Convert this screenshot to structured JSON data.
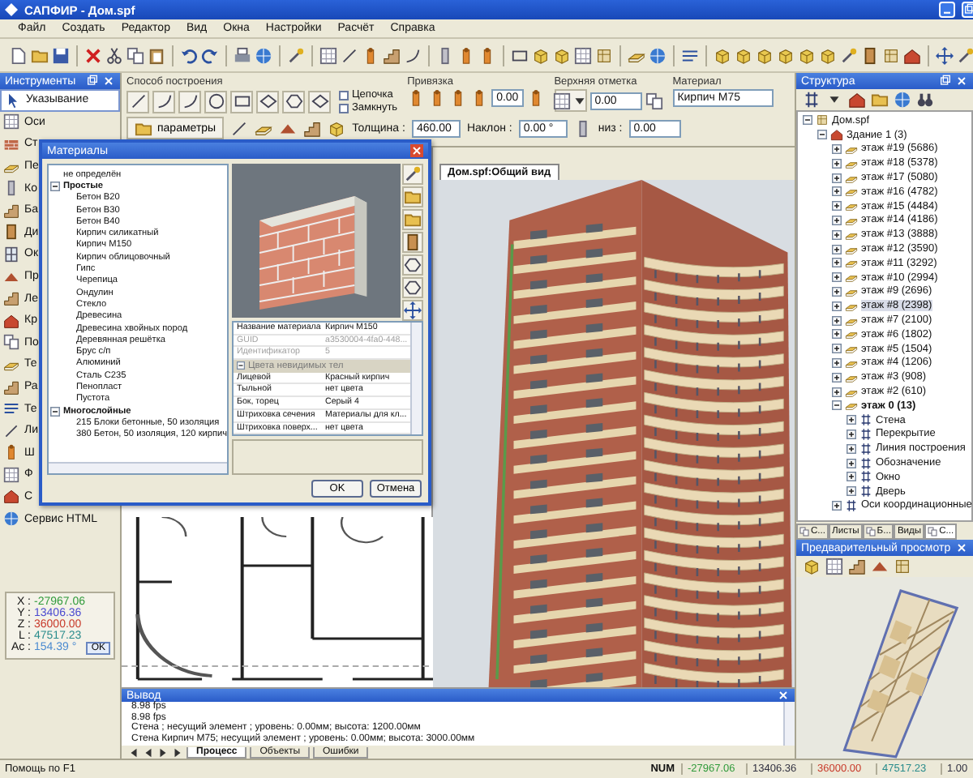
{
  "window": {
    "title": "САПФИР - Дом.spf"
  },
  "menu": [
    "Файл",
    "Создать",
    "Редактор",
    "Вид",
    "Окна",
    "Настройки",
    "Расчёт",
    "Справка"
  ],
  "tools_panel": {
    "title": "Инструменты",
    "items": [
      {
        "label": "Указывание",
        "selected": true
      },
      {
        "label": "Оси",
        "selected": false
      },
      {
        "label": "Ст",
        "selected": false
      },
      {
        "label": "Пе",
        "selected": false
      },
      {
        "label": "Ко",
        "selected": false
      },
      {
        "label": "Ба",
        "selected": false
      },
      {
        "label": "Ди",
        "selected": false
      },
      {
        "label": "Ок",
        "selected": false
      },
      {
        "label": "Пр",
        "selected": false
      },
      {
        "label": "Ле",
        "selected": false
      },
      {
        "label": "Кр",
        "selected": false
      },
      {
        "label": "По",
        "selected": false
      },
      {
        "label": "Те",
        "selected": false
      },
      {
        "label": "Ра",
        "selected": false
      },
      {
        "label": "Те",
        "selected": false
      },
      {
        "label": "Ли",
        "selected": false
      },
      {
        "label": "Ш",
        "selected": false
      },
      {
        "label": "Ф",
        "selected": false
      },
      {
        "label": "С",
        "selected": false
      },
      {
        "label": "Сервис HTML",
        "selected": false
      }
    ]
  },
  "coordinates": [
    {
      "label": "X :",
      "value": "-27967.06",
      "color": "#2f9a3a"
    },
    {
      "label": "Y :",
      "value": "13406.36",
      "color": "#4a4ad0"
    },
    {
      "label": "Z :",
      "value": "36000.00",
      "color": "#c83a2a"
    },
    {
      "label": "L :",
      "value": "47517.23",
      "color": "#2a8c8c"
    },
    {
      "label": "Ас :",
      "value": "154.39 °",
      "color": "#4a8ad0"
    }
  ],
  "coordinates_button": "OK",
  "construction": {
    "caption": "Способ построения",
    "chain": {
      "label": "Цепочка",
      "checked": false
    },
    "close": {
      "label": "Замкнуть",
      "checked": false
    },
    "params_button": "параметры",
    "thickness": {
      "label": "Толщина :",
      "value": "460.00"
    },
    "tilt": {
      "label": "Наклон :",
      "value": "0.00 °"
    },
    "bottom": {
      "label": "низ :",
      "value": "0.00"
    }
  },
  "snap": {
    "caption": "Привязка",
    "value": "0.00"
  },
  "top_mark": {
    "caption": "Верхняя отметка",
    "value": "0.00"
  },
  "material": {
    "caption": "Материал",
    "value": "Кирпич M75"
  },
  "document_tab": "Дом.spf:Общий вид",
  "materials_dialog": {
    "title": "Материалы",
    "tree": [
      {
        "label": "не определён",
        "kind": "item"
      },
      {
        "label": "Простые",
        "kind": "group",
        "expanded": true,
        "children": [
          {
            "label": "Бетон B20",
            "kind": "item"
          },
          {
            "label": "Бетон B30",
            "kind": "item"
          },
          {
            "label": "Бетон B40",
            "kind": "item"
          },
          {
            "label": "Кирпич силикатный",
            "kind": "item"
          },
          {
            "label": "Кирпич M150",
            "kind": "item"
          },
          {
            "label": "Кирпич облицовочный",
            "kind": "item"
          },
          {
            "label": "Гипс",
            "kind": "item"
          },
          {
            "label": "Черепица",
            "kind": "item"
          },
          {
            "label": "Ондулин",
            "kind": "item"
          },
          {
            "label": "Стекло",
            "kind": "item"
          },
          {
            "label": "Древесина",
            "kind": "item"
          },
          {
            "label": "Древесина хвойных пород",
            "kind": "item"
          },
          {
            "label": "Деревянная решётка",
            "kind": "item"
          },
          {
            "label": "Брус с/п",
            "kind": "item"
          },
          {
            "label": "Алюминий",
            "kind": "item"
          },
          {
            "label": "Сталь С235",
            "kind": "item"
          },
          {
            "label": "Пенопласт",
            "kind": "item"
          },
          {
            "label": "Пустота",
            "kind": "item"
          }
        ]
      },
      {
        "label": "Многослойные",
        "kind": "group",
        "expanded": true,
        "children": [
          {
            "label": "215 Блоки бетонные, 50 изоляция",
            "kind": "item"
          },
          {
            "label": "380 Бетон, 50 изоляция, 120 кирпич",
            "kind": "item"
          }
        ]
      }
    ],
    "properties": [
      {
        "kind": "property",
        "name": "Название материала",
        "value": "Кирпич M150",
        "disabled": false
      },
      {
        "kind": "property",
        "name": "GUID",
        "value": "a3530004-4fa0-448...",
        "disabled": true
      },
      {
        "kind": "property",
        "name": "Идентификатор",
        "value": "5",
        "disabled": true
      },
      {
        "kind": "section",
        "name": "Цвета невидимых тел",
        "expanded": true,
        "disabled": true
      },
      {
        "kind": "property",
        "name": "Лицевой",
        "value": "Красный кирпич",
        "disabled": false
      },
      {
        "kind": "property",
        "name": "Тыльной",
        "value": "нет цвета",
        "disabled": false
      },
      {
        "kind": "property",
        "name": "Бок, торец",
        "value": "Серый 4",
        "disabled": false
      },
      {
        "kind": "property",
        "name": "Штриховка сечения",
        "value": "Материалы для кл...",
        "disabled": false
      },
      {
        "kind": "property",
        "name": "Штриховка поверх...",
        "value": "нет цвета",
        "disabled": false
      }
    ],
    "ok": "OK",
    "cancel": "Отмена"
  },
  "output": {
    "title": "Вывод",
    "lines": [
      "8.98 fps",
      "8.98 fps",
      "Стена ; несущий элемент ; уровень: 0.00мм; высота: 1200.00мм",
      "Стена Кирпич M75; несущий элемент ; уровень: 0.00мм; высота: 3000.00мм"
    ],
    "tabs": [
      {
        "label": "Процесс",
        "selected": true
      },
      {
        "label": "Объекты",
        "selected": false
      },
      {
        "label": "Ошибки",
        "selected": false
      }
    ]
  },
  "structure": {
    "title": "Структура",
    "tree": [
      {
        "label": "Дом.spf",
        "kind": "file",
        "expanded": true,
        "selected": false,
        "current": false,
        "children": [
          {
            "label": "Здание 1 (3)",
            "kind": "building",
            "expanded": true,
            "selected": false,
            "current": false,
            "children": [
              {
                "label": "этаж #19 (5686)",
                "kind": "floor",
                "expanded": false,
                "selected": false,
                "current": false
              },
              {
                "label": "этаж #18 (5378)",
                "kind": "floor",
                "expanded": false,
                "selected": false,
                "current": false
              },
              {
                "label": "этаж #17 (5080)",
                "kind": "floor",
                "expanded": false,
                "selected": false,
                "current": false
              },
              {
                "label": "этаж #16 (4782)",
                "kind": "floor",
                "expanded": false,
                "selected": false,
                "current": false
              },
              {
                "label": "этаж #15 (4484)",
                "kind": "floor",
                "expanded": false,
                "selected": false,
                "current": false
              },
              {
                "label": "этаж #14 (4186)",
                "kind": "floor",
                "expanded": false,
                "selected": false,
                "current": false
              },
              {
                "label": "этаж #13 (3888)",
                "kind": "floor",
                "expanded": false,
                "selected": false,
                "current": false
              },
              {
                "label": "этаж #12 (3590)",
                "kind": "floor",
                "expanded": false,
                "selected": false,
                "current": false
              },
              {
                "label": "этаж #11 (3292)",
                "kind": "floor",
                "expanded": false,
                "selected": false,
                "current": false
              },
              {
                "label": "этаж #10 (2994)",
                "kind": "floor",
                "expanded": false,
                "selected": false,
                "current": false
              },
              {
                "label": "этаж #9 (2696)",
                "kind": "floor",
                "expanded": false,
                "selected": false,
                "current": false
              },
              {
                "label": "этаж #8 (2398)",
                "kind": "floor",
                "expanded": false,
                "selected": true,
                "current": false
              },
              {
                "label": "этаж #7 (2100)",
                "kind": "floor",
                "expanded": false,
                "selected": false,
                "current": false
              },
              {
                "label": "этаж #6 (1802)",
                "kind": "floor",
                "expanded": false,
                "selected": false,
                "current": false
              },
              {
                "label": "этаж #5 (1504)",
                "kind": "floor",
                "expanded": false,
                "selected": false,
                "current": false
              },
              {
                "label": "этаж #4 (1206)",
                "kind": "floor",
                "expanded": false,
                "selected": false,
                "current": false
              },
              {
                "label": "этаж #3 (908)",
                "kind": "floor",
                "expanded": false,
                "selected": false,
                "current": false
              },
              {
                "label": "этаж #2 (610)",
                "kind": "floor",
                "expanded": false,
                "selected": false,
                "current": false
              },
              {
                "label": "этаж 0 (13)",
                "kind": "floor",
                "expanded": true,
                "selected": false,
                "current": true,
                "children": [
                  {
                    "label": "Стена",
                    "kind": "category",
                    "expanded": false,
                    "selected": false,
                    "current": false
                  },
                  {
                    "label": "Перекрытие",
                    "kind": "category",
                    "expanded": false,
                    "selected": false,
                    "current": false
                  },
                  {
                    "label": "Линия построения",
                    "kind": "category",
                    "expanded": false,
                    "selected": false,
                    "current": false
                  },
                  {
                    "label": "Обозначение",
                    "kind": "category",
                    "expanded": false,
                    "selected": false,
                    "current": false
                  },
                  {
                    "label": "Окно",
                    "kind": "category",
                    "expanded": false,
                    "selected": false,
                    "current": false
                  },
                  {
                    "label": "Дверь",
                    "kind": "category",
                    "expanded": false,
                    "selected": false,
                    "current": false
                  }
                ]
              },
              {
                "label": "Оси координационные",
                "kind": "category",
                "expanded": false,
                "selected": false,
                "current": false
              }
            ]
          }
        ]
      }
    ]
  },
  "structure_tabs": [
    {
      "label": "С...",
      "kind": "iconic",
      "selected": false
    },
    {
      "label": "Листы",
      "kind": "plain",
      "selected": false
    },
    {
      "label": "Б...",
      "kind": "iconic",
      "selected": false
    },
    {
      "label": "Виды",
      "kind": "plain",
      "selected": false
    },
    {
      "label": "С...",
      "kind": "iconic",
      "selected": true
    }
  ],
  "preview": {
    "title": "Предварительный просмотр"
  },
  "status": {
    "help": "Помощь по F1",
    "indicator": "NUM",
    "fields": [
      {
        "value": "-27967.06",
        "color": "#2f9a3a"
      },
      {
        "value": "13406.36",
        "color": "#303040"
      },
      {
        "value": "36000.00",
        "color": "#c83a2a"
      },
      {
        "value": "47517.23",
        "color": "#2a8c8c"
      },
      {
        "value": "1.00",
        "color": "#303040"
      }
    ]
  }
}
